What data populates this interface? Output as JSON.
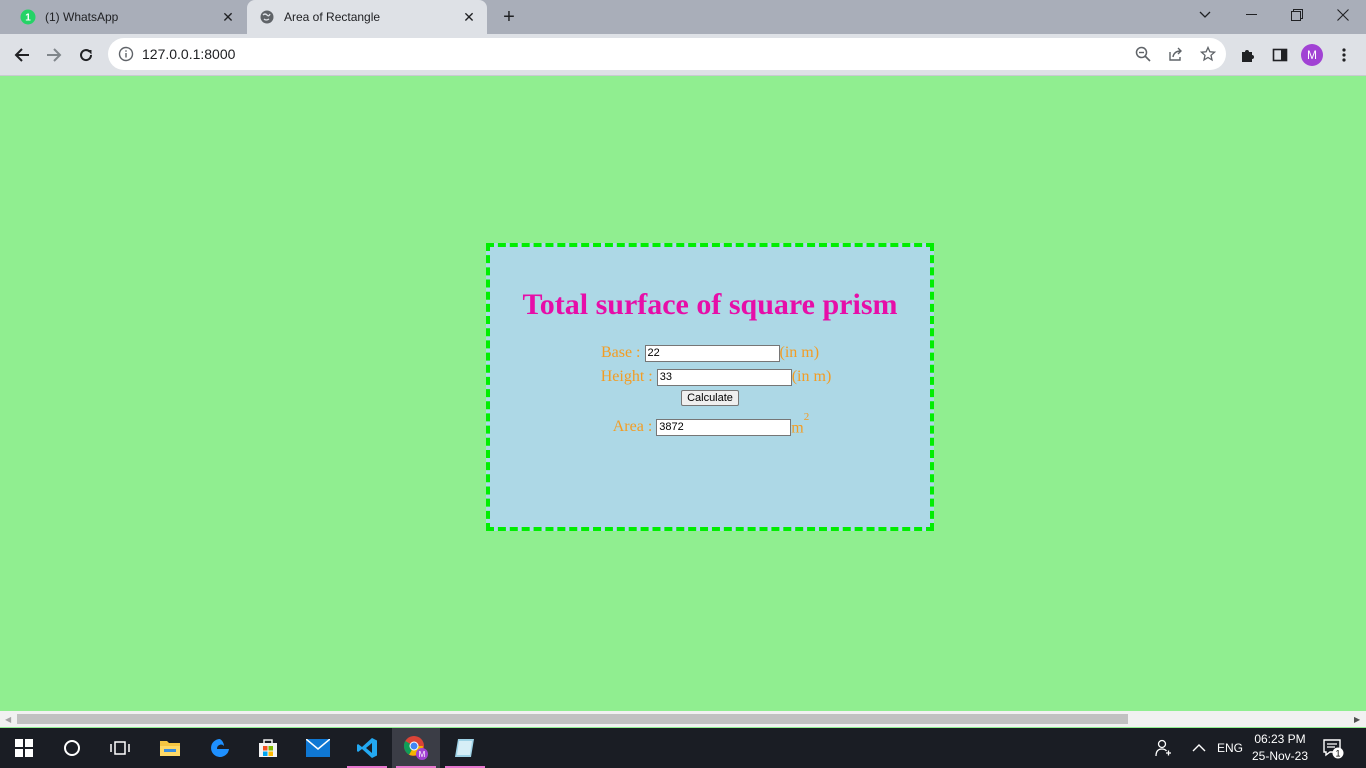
{
  "browser": {
    "tabs": [
      {
        "title": "(1) WhatsApp",
        "favicon": "whatsapp-icon",
        "badge": "1",
        "active": false
      },
      {
        "title": "Area of Rectangle",
        "favicon": "globe-icon",
        "active": true
      }
    ],
    "url": "127.0.0.1:8000",
    "profile_initial": "M"
  },
  "page": {
    "heading": "Total surface of square prism",
    "base_label": "Base :",
    "base_value": "22",
    "base_unit": "(in m)",
    "height_label": "Height :",
    "height_value": "33",
    "height_unit": "(in m)",
    "calculate_label": "Calculate",
    "area_label": "Area :",
    "area_value": "3872",
    "area_unit": "m",
    "area_unit_sup": "2"
  },
  "taskbar": {
    "language": "ENG",
    "time": "06:23 PM",
    "date": "25-Nov-23",
    "notification_count": "1",
    "chrome_badge": "M"
  },
  "colors": {
    "page_bg": "#90ee90",
    "card_bg": "#add8e6",
    "card_border": "#00ee00",
    "heading": "#e60ea8",
    "label": "#f39c23"
  }
}
